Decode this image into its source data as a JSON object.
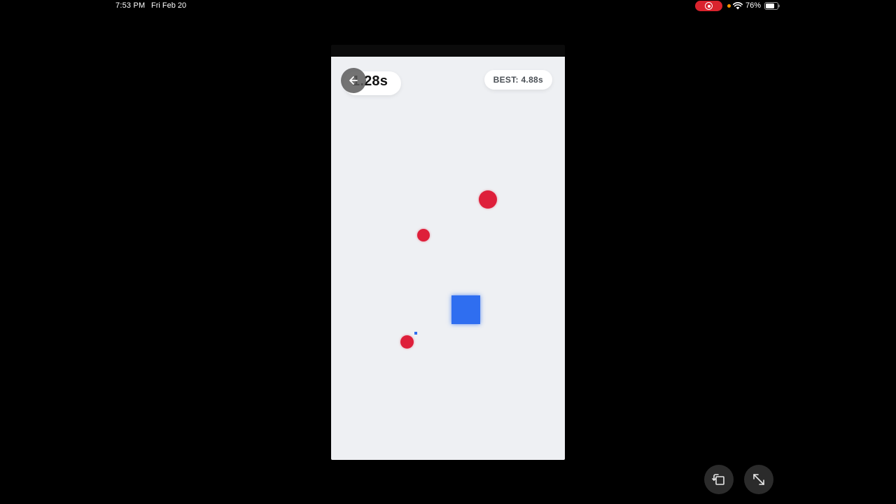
{
  "status_bar": {
    "time": "7:53 PM",
    "date": "Fri Feb 20",
    "battery_percent": "76%",
    "recording": true,
    "battery_level": 0.76
  },
  "game": {
    "timer": "1.28s",
    "best": "BEST: 4.88s",
    "back_icon": "arrow-left-icon",
    "player_color": "#2f6ef0",
    "enemy_color": "#de1f3a",
    "background_color": "#eef0f3"
  },
  "controls": {
    "rotate_icon": "rotate-icon",
    "expand_icon": "expand-icon"
  }
}
